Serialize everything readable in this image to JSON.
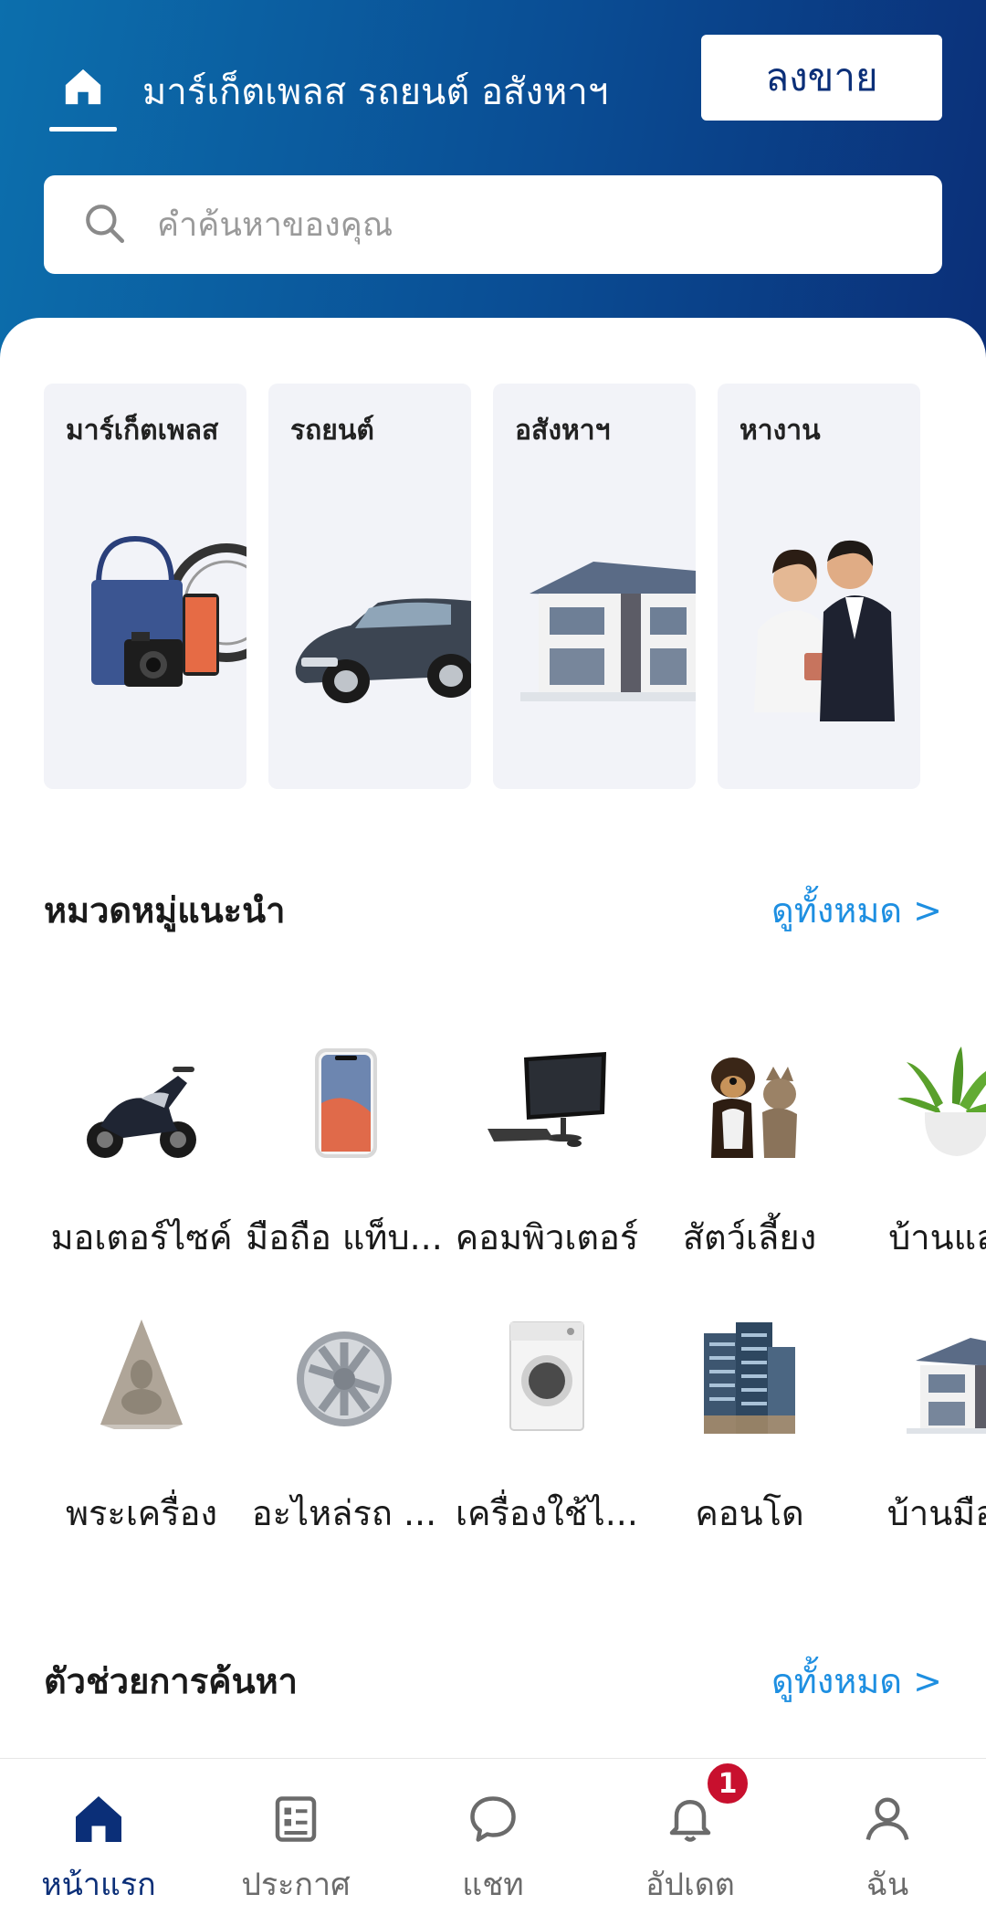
{
  "header": {
    "title": "มาร์เก็ตเพลส รถยนต์ อสังหาฯ",
    "post_button": "ลงขาย"
  },
  "search": {
    "placeholder": "คำค้นหาของคุณ"
  },
  "verticals": [
    {
      "label": "มาร์เก็ตเพลส",
      "icon": "marketplace-goods-icon"
    },
    {
      "label": "รถยนต์",
      "icon": "car-icon"
    },
    {
      "label": "อสังหาฯ",
      "icon": "house-icon"
    },
    {
      "label": "หางาน",
      "icon": "jobs-people-icon"
    }
  ],
  "recommended": {
    "title": "หมวดหมู่แนะนำ",
    "see_all": "ดูทั้งหมด >",
    "categories": [
      {
        "label": "มอเตอร์ไซค์",
        "icon": "motorcycle-icon"
      },
      {
        "label": "มือถือ แท็บ...",
        "icon": "smartphone-icon"
      },
      {
        "label": "คอมพิวเตอร์",
        "icon": "computer-icon"
      },
      {
        "label": "สัตว์เลี้ยง",
        "icon": "pets-icon"
      },
      {
        "label": "บ้านและ",
        "icon": "houseplant-icon"
      },
      {
        "label": "พระเครื่อง",
        "icon": "amulet-icon"
      },
      {
        "label": "อะไหล่รถ ...",
        "icon": "wheel-icon"
      },
      {
        "label": "เครื่องใช้ไ...",
        "icon": "washing-machine-icon"
      },
      {
        "label": "คอนโด",
        "icon": "condo-icon"
      },
      {
        "label": "บ้านมือส",
        "icon": "house-icon"
      }
    ]
  },
  "search_helper": {
    "title": "ตัวช่วยการค้นหา",
    "see_all": "ดูทั้งหมด >"
  },
  "bottom_nav": {
    "items": [
      {
        "label": "หน้าแรก",
        "icon": "home-icon",
        "active": true
      },
      {
        "label": "ประกาศ",
        "icon": "listings-icon",
        "active": false
      },
      {
        "label": "แชท",
        "icon": "chat-icon",
        "active": false
      },
      {
        "label": "อัปเดต",
        "icon": "bell-icon",
        "active": false
      },
      {
        "label": "ฉัน",
        "icon": "profile-icon",
        "active": false
      }
    ],
    "updates_badge": "1"
  },
  "colors": {
    "brand_navy": "#0b2f78",
    "header_blue": "#0c6fad",
    "link_blue": "#1e8fe1",
    "badge_red": "#c8102e"
  }
}
